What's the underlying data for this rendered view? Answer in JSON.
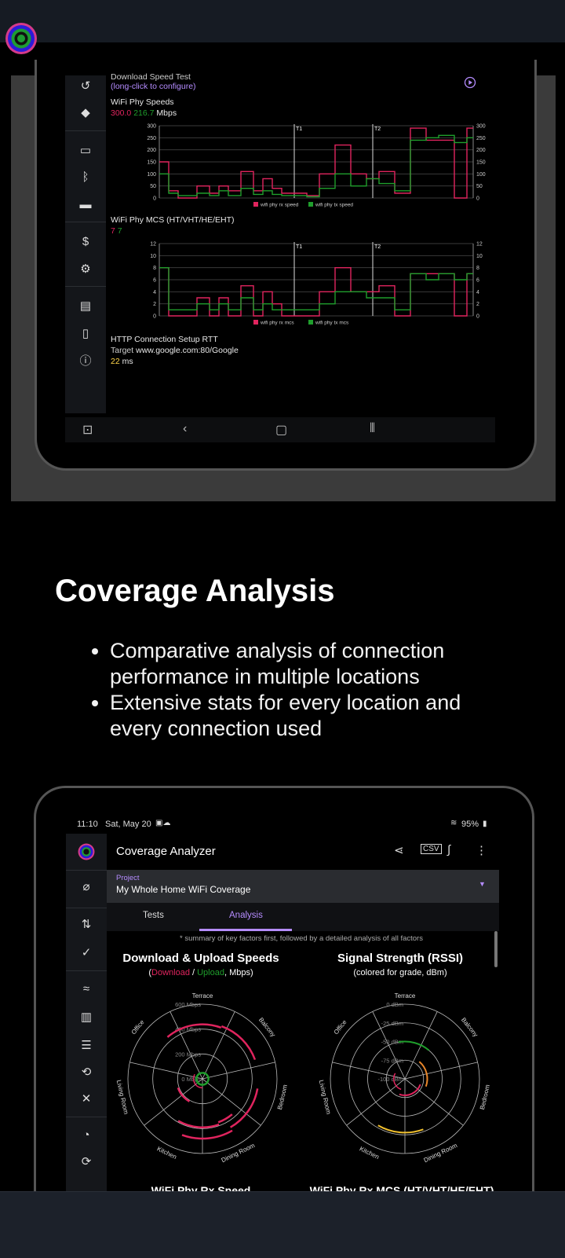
{
  "section1": {
    "download_test_title": "Download Speed Test",
    "download_test_hint": "(long-click to configure)",
    "phy_speeds_title": "WiFi Phy Speeds",
    "phy_speeds_rx": "300.0",
    "phy_speeds_tx": "216.7",
    "phy_speeds_unit": "Mbps",
    "mcs_title": "WiFi Phy MCS (HT/VHT/HE/EHT)",
    "mcs_rx": "7",
    "mcs_tx": "7",
    "rtt_title": "HTTP Connection Setup RTT",
    "rtt_target_label": "Target",
    "rtt_target": "www.google.com:80/Google",
    "rtt_value": "22",
    "rtt_unit": "ms",
    "marker_t1": "T1",
    "marker_t2": "T2",
    "colors": {
      "rx": "#e0245e",
      "tx": "#1f9e2c",
      "accent": "#b58cff",
      "rtt": "#ffd54a"
    }
  },
  "chart_data": [
    {
      "type": "line",
      "title": "WiFi Phy Speeds",
      "ylim": [
        0,
        300
      ],
      "yticks": [
        0,
        50,
        100,
        150,
        200,
        250,
        300
      ],
      "series": [
        {
          "name": "wifi phy rx speed",
          "color": "#e0245e",
          "x": [
            0,
            3,
            3,
            6,
            6,
            12,
            12,
            16,
            16,
            19,
            19,
            22,
            22,
            26,
            26,
            30,
            30,
            33,
            33,
            36,
            36,
            39,
            39,
            43,
            43,
            47,
            47,
            51,
            51,
            56,
            56,
            61,
            61,
            66,
            66,
            70,
            70,
            75,
            75,
            80,
            80,
            85,
            85,
            89,
            89,
            94,
            94,
            98,
            98,
            100
          ],
          "y": [
            150,
            150,
            30,
            30,
            0,
            0,
            50,
            50,
            20,
            20,
            50,
            50,
            30,
            30,
            110,
            110,
            30,
            30,
            80,
            80,
            40,
            40,
            20,
            20,
            20,
            20,
            10,
            10,
            100,
            100,
            220,
            220,
            100,
            100,
            80,
            80,
            110,
            110,
            20,
            20,
            290,
            290,
            240,
            240,
            240,
            240,
            0,
            0,
            290,
            290
          ]
        },
        {
          "name": "wifi phy tx speed",
          "color": "#1f9e2c",
          "x": [
            0,
            3,
            3,
            6,
            6,
            12,
            12,
            16,
            16,
            19,
            19,
            22,
            22,
            26,
            26,
            30,
            30,
            33,
            33,
            36,
            36,
            39,
            39,
            43,
            43,
            47,
            47,
            51,
            51,
            56,
            56,
            61,
            61,
            66,
            66,
            70,
            70,
            75,
            75,
            80,
            80,
            85,
            85,
            89,
            89,
            94,
            94,
            98,
            98,
            100
          ],
          "y": [
            100,
            100,
            20,
            20,
            10,
            10,
            20,
            20,
            10,
            10,
            30,
            30,
            10,
            10,
            40,
            40,
            15,
            15,
            30,
            30,
            15,
            15,
            10,
            10,
            10,
            10,
            5,
            5,
            40,
            40,
            100,
            100,
            50,
            50,
            80,
            80,
            60,
            60,
            30,
            30,
            240,
            240,
            250,
            250,
            260,
            260,
            230,
            230,
            250,
            250
          ]
        }
      ],
      "markers": [
        "T1",
        "T2"
      ]
    },
    {
      "type": "line",
      "title": "WiFi Phy MCS (HT/VHT/HE/EHT)",
      "ylim": [
        0,
        12
      ],
      "yticks": [
        0,
        2,
        4,
        6,
        8,
        10,
        12
      ],
      "series": [
        {
          "name": "wifi phy rx mcs",
          "color": "#e0245e",
          "x": [
            0,
            3,
            3,
            6,
            6,
            12,
            12,
            16,
            16,
            19,
            19,
            22,
            22,
            26,
            26,
            30,
            30,
            33,
            33,
            36,
            36,
            39,
            39,
            43,
            43,
            47,
            47,
            51,
            51,
            56,
            56,
            61,
            61,
            66,
            66,
            70,
            70,
            75,
            75,
            80,
            80,
            85,
            85,
            89,
            89,
            94,
            94,
            98,
            98,
            100
          ],
          "y": [
            8,
            8,
            0,
            0,
            0,
            0,
            3,
            3,
            0,
            0,
            3,
            3,
            0,
            0,
            5,
            5,
            0,
            0,
            4,
            4,
            2,
            2,
            0,
            0,
            0,
            0,
            0,
            0,
            4,
            4,
            8,
            8,
            4,
            4,
            4,
            4,
            5,
            5,
            0,
            0,
            7,
            7,
            7,
            7,
            7,
            7,
            0,
            0,
            7,
            7
          ]
        },
        {
          "name": "wifi phy tx mcs",
          "color": "#1f9e2c",
          "x": [
            0,
            3,
            3,
            6,
            6,
            12,
            12,
            16,
            16,
            19,
            19,
            22,
            22,
            26,
            26,
            30,
            30,
            33,
            33,
            36,
            36,
            39,
            39,
            43,
            43,
            47,
            47,
            51,
            51,
            56,
            56,
            61,
            61,
            66,
            66,
            70,
            70,
            75,
            75,
            80,
            80,
            85,
            85,
            89,
            89,
            94,
            94,
            98,
            98,
            100
          ],
          "y": [
            8,
            8,
            1,
            1,
            1,
            1,
            2,
            2,
            1,
            1,
            2,
            2,
            1,
            1,
            3,
            3,
            1,
            1,
            2,
            2,
            1,
            1,
            1,
            1,
            1,
            1,
            1,
            1,
            2,
            2,
            4,
            4,
            4,
            4,
            3,
            3,
            3,
            3,
            1,
            1,
            7,
            7,
            6,
            6,
            7,
            7,
            6,
            6,
            7,
            7
          ]
        }
      ],
      "markers": [
        "T1",
        "T2"
      ]
    }
  ],
  "heading": "Coverage Analysis",
  "bullets": [
    "Comparative analysis of connection performance in multiple locations",
    "Extensive stats for every location and every connection used"
  ],
  "app": {
    "status_time": "11:10",
    "status_date": "Sat, May 20",
    "battery": "95%",
    "title": "Coverage Analyzer",
    "project_label": "Project",
    "project_value": "My Whole Home WiFi Coverage",
    "tabs": [
      "Tests",
      "Analysis"
    ],
    "summary_note": "* summary of key factors first, followed by a detailed analysis of all factors",
    "speeds_title": "Download & Upload Speeds",
    "speeds_sub_open": "(",
    "speeds_sub_download": "Download",
    "speeds_sub_slash": " / ",
    "speeds_sub_upload": "Upload",
    "speeds_sub_close": ", Mbps)",
    "rssi_title": "Signal Strength (RSSI)",
    "rssi_sub": "(colored for grade, dBm)",
    "rooms": [
      "Terrace",
      "Balcony",
      "Bedroom",
      "Dining Room",
      "Kitchen",
      "Living Room",
      "Office"
    ],
    "speed_rings": [
      "0 Mbps",
      "200 Mbps",
      "400 Mbps",
      "600 Mbps"
    ],
    "rssi_rings": [
      "-100 dBm",
      "-75 dBm",
      "-50 dBm",
      "-25 dBm",
      "0 dBm"
    ],
    "bottom_left": "WiFi Phy Rx Speed",
    "bottom_right": "WiFi Phy Rx MCS (HT/VHT/HE/EHT)"
  }
}
